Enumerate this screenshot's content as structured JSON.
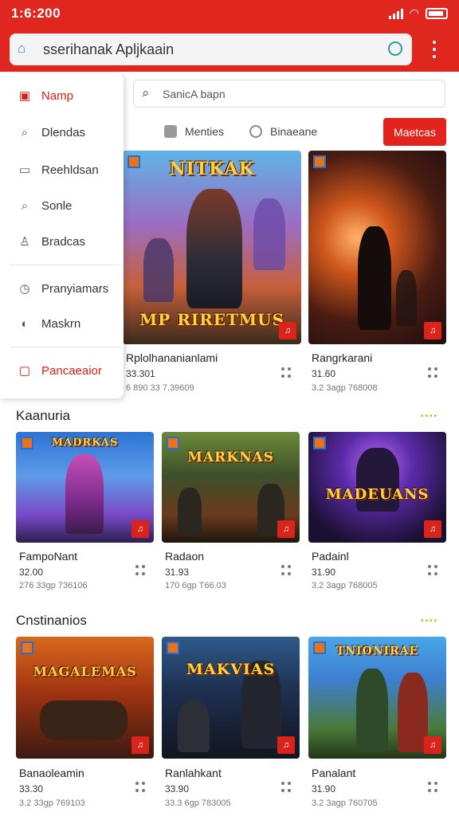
{
  "status": {
    "time": "1:6:200"
  },
  "browser": {
    "url_text": "sserihanak Apljkaain"
  },
  "drawer": {
    "items": [
      {
        "label": "Namp",
        "icon": "list-icon",
        "accent": true
      },
      {
        "label": "Dlendas",
        "icon": "search-icon",
        "accent": false
      },
      {
        "label": "Reehldsan",
        "icon": "window-icon",
        "accent": false
      },
      {
        "label": "Sonle",
        "icon": "search-icon",
        "accent": false
      },
      {
        "label": "Bradcas",
        "icon": "user-icon",
        "accent": false
      },
      {
        "label": "Pranyiamars",
        "icon": "clock-icon",
        "accent": false
      },
      {
        "label": "Maskrn",
        "icon": "mask-icon",
        "accent": false
      },
      {
        "label": "Pancaeaior",
        "icon": "book-icon",
        "accent": true
      }
    ]
  },
  "filters": {
    "search_placeholder": "SanicA bapn",
    "chip1": "Menties",
    "chip2": "Binaeane",
    "button": "Maetcas"
  },
  "featured": [
    {
      "name": "Rplolhananianlami",
      "price": "33.301",
      "meta": "6 890 33 7.39609",
      "art_title": "NITKAK",
      "art_sub": "MP RIRETMUS",
      "badge": "♫"
    },
    {
      "name": "Rangrkarani",
      "price": "31.60",
      "meta": "3.2 3agp 768008",
      "art_title": "",
      "art_sub": "",
      "badge": "♫"
    }
  ],
  "sections": [
    {
      "title": "Kaanuria",
      "more": "••••",
      "cards": [
        {
          "name": "FampoNant",
          "price": "32.00",
          "meta": "276 33gp 736106",
          "art_title": "MADRKAS",
          "badge": "♫"
        },
        {
          "name": "Radaon",
          "price": "31.93",
          "meta": "170 6gp T66.03",
          "art_title": "MARKNAS",
          "badge": "♫"
        },
        {
          "name": "Padainl",
          "price": "31.90",
          "meta": "3.2 3agp 768005",
          "art_title": "MADEUANS",
          "badge": "♫"
        }
      ]
    },
    {
      "title": "Cnstinanios",
      "more": "••••",
      "cards": [
        {
          "name": "Banaoleamin",
          "price": "33.30",
          "meta": "3.2 33gp 769103",
          "art_title": "MAGALEMAS",
          "badge": "♫"
        },
        {
          "name": "Ranlahkant",
          "price": "33.90",
          "meta": "33.3 6gp 783005",
          "art_title": "MAKVIAS",
          "badge": "♫"
        },
        {
          "name": "Panalant",
          "price": "31.90",
          "meta": "3.2 3agp 760705",
          "art_title": "TNIONIRAE",
          "badge": "♫"
        }
      ]
    }
  ],
  "colors": {
    "brand": "#e0271f",
    "accent_text": "#d32018"
  }
}
